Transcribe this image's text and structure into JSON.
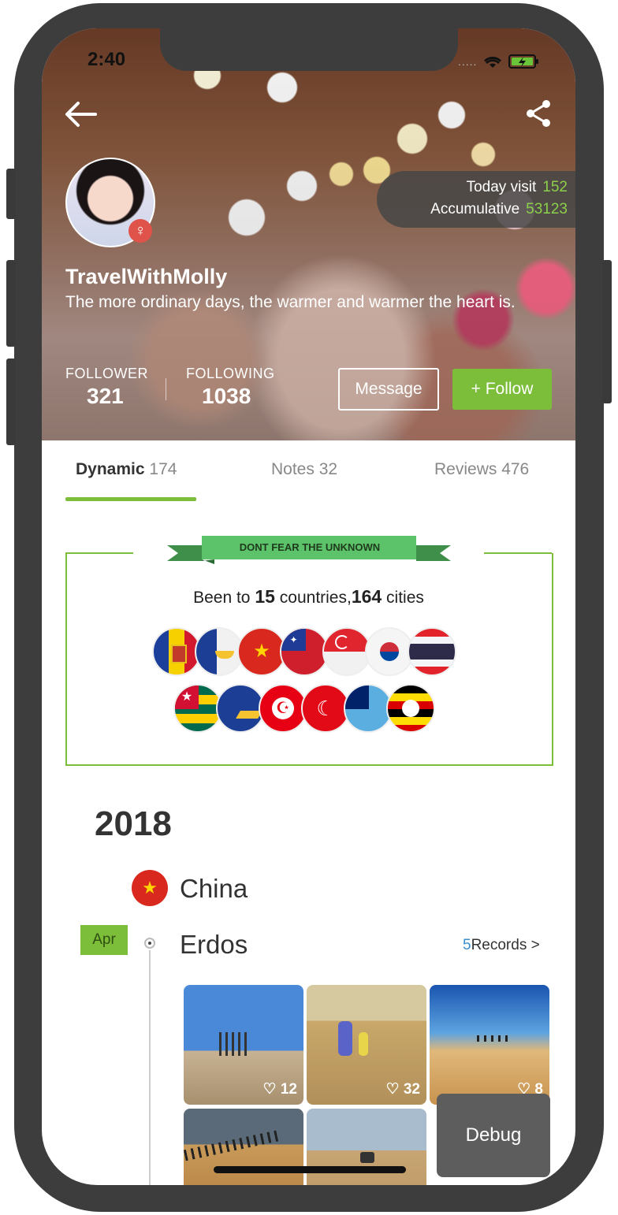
{
  "status_bar": {
    "time": "2:40"
  },
  "profile": {
    "username": "TravelWithMolly",
    "motto": "The more ordinary days, the warmer and warmer the heart is.",
    "visits": {
      "today_label": "Today visit",
      "today_value": "152",
      "total_label": "Accumulative",
      "total_value": "53123"
    },
    "follower_label": "FOLLOWER",
    "follower_value": "321",
    "following_label": "FOLLOWING",
    "following_value": "1038",
    "message_label": "Message",
    "follow_label": "+ Follow"
  },
  "tabs": [
    {
      "label": "Dynamic",
      "count": "174",
      "active": true
    },
    {
      "label": "Notes",
      "count": "32",
      "active": false
    },
    {
      "label": "Reviews",
      "count": "476",
      "active": false
    }
  ],
  "summary": {
    "ribbon": "DONT FEAR THE UNKNOWN",
    "prefix": "Been to",
    "countries_count": "15",
    "countries_word": "countries,",
    "cities_count": "164",
    "cities_word": "cities",
    "flags_row1": [
      "andorra",
      "tokelau",
      "china",
      "samoa",
      "singapore",
      "south-korea",
      "thailand"
    ],
    "flags_row2": [
      "togo",
      "tokelau",
      "tunisia",
      "turkey",
      "tuvalu",
      "uganda"
    ]
  },
  "timeline": {
    "year": "2018",
    "country": "China",
    "month": "Apr",
    "city": "Erdos",
    "records_count": "5",
    "records_label": "Records",
    "records_chevron": ">",
    "photos": [
      {
        "likes": "12"
      },
      {
        "likes": "32"
      },
      {
        "likes": "8"
      },
      {
        "likes": ""
      },
      {
        "likes": ""
      }
    ]
  },
  "debug_label": "Debug",
  "colors": {
    "accent": "#7cbe3a",
    "link": "#3a8fd0",
    "visit_number": "#8bd04a"
  }
}
